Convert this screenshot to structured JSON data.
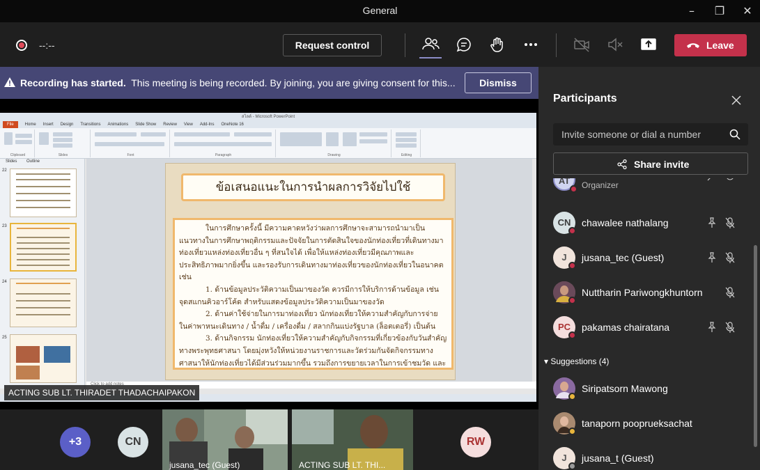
{
  "window": {
    "title": "General"
  },
  "toolbar": {
    "timer": "--:--",
    "request_control_label": "Request control",
    "leave_label": "Leave"
  },
  "banner": {
    "bold": "Recording has started.",
    "text": "This meeting is being recorded. By joining, you are giving consent for this...",
    "dismiss_label": "Dismiss"
  },
  "ppt": {
    "title": "สไลด์ - Microsoft PowerPoint",
    "tabs": [
      "File",
      "Home",
      "Insert",
      "Design",
      "Transitions",
      "Animations",
      "Slide Show",
      "Review",
      "View",
      "Add-Ins",
      "OneNote 16"
    ],
    "ribbon_groups": [
      "Clipboard",
      "Slides",
      "Font",
      "Paragraph",
      "Drawing",
      "Editing"
    ],
    "pane_tabs": [
      "Slides",
      "Outline"
    ],
    "thumb_numbers": [
      "22",
      "23",
      "24",
      "25"
    ],
    "notes_placeholder": "Click to add notes"
  },
  "slide": {
    "title": "ข้อเสนอแนะในการนำผลการวิจัยไปใช้",
    "body": [
      "ในการศึกษาครั้งนี้ มีความคาดหวังว่าผลการศึกษาจะสามารถนำมาเป็นแนวทางในการศึกษาพฤติกรรมและปัจจัยในการตัดสินใจของนักท่องเที่ยวที่เดินทางมาท่องเที่ยวแหล่งท่องเที่ยวอื่น ๆ ที่สนใจได้ เพื่อให้แหล่งท่องเที่ยวมีคุณภาพและประสิทธิภาพมากยิ่งขึ้น และรองรับการเดินทางมาท่องเที่ยวของนักท่องเที่ยวในอนาคต เช่น",
      "1. ด้านข้อมูลประวัติความเป็นมาของวัด ควรมีการให้บริการด้านข้อมูล เช่น จุดสแกนคิวอาร์โค้ด สำหรับแสดงข้อมูลประวัติความเป็นมาของวัด",
      "2. ด้านค่าใช้จ่ายในการมาท่องเที่ยว นักท่องเที่ยวให้ความสำคัญกับการจ่าย ในค่าพาหนะเดินทาง / น้ำดื่ม / เครื่องดื่ม / สลากกินแบ่งรัฐบาล (ล็อตเตอรี่) เป็นต้น",
      "3. ด้านกิจกรรม นักท่องเที่ยวให้ความสำคัญกับกิจกรรมที่เกี่ยวข้องกับวันสำคัญทางพระพุทธศาสนา โดยมุ่งหวังให้หน่วยงานราชการและวัดร่วมกันจัดกิจกรรมทางศาสนาให้นักท่องเที่ยวได้มีส่วนร่วมมากขึ้น รวมถึงการขยายเวลาในการเข้าชมวัด และจัดรอบเข้าชมเพื่อไม่ให้นักท่องเที่ยวมีจำนวนมากเกินไปในแต่ละรอบ"
    ]
  },
  "presenter": {
    "name": "ACTING SUB LT. THIRADET THADACHAIPAKON"
  },
  "gallery": {
    "more_count": "+3",
    "avatars": [
      "CN",
      "RW"
    ],
    "tiles": [
      {
        "label": "jusana_tec (Guest)"
      },
      {
        "label": "ACTING SUB LT. THI..."
      }
    ]
  },
  "participants": {
    "title": "Participants",
    "invite_placeholder": "Invite someone or dial a number",
    "share_invite_label": "Share invite",
    "organizer": {
      "initials": "AT",
      "role": "Organizer"
    },
    "people": [
      {
        "initials": "CN",
        "name": "chawalee nathalang",
        "bg": "#d9e3e5",
        "fg": "#3b3b3b"
      },
      {
        "initials": "J",
        "name": "jusana_tec (Guest)",
        "bg": "#f1e4dc",
        "fg": "#555"
      },
      {
        "initials": "",
        "name": "Nuttharin Pariwongkhuntorn",
        "bg": "#7a5a6a",
        "fg": "#fff"
      },
      {
        "initials": "PC",
        "name": "pakamas chairatana",
        "bg": "#f5dede",
        "fg": "#a33"
      }
    ],
    "suggestions_header": "Suggestions (4)",
    "suggestions": [
      {
        "initials": "",
        "name": "Siripatsorn Mawong",
        "bg": "#8a6aa0"
      },
      {
        "initials": "",
        "name": "tanaporn pooprueksachat",
        "bg": "#a98a70"
      },
      {
        "initials": "J",
        "name": "jusana_t (Guest)",
        "bg": "#f1e4dc"
      }
    ]
  },
  "colors": {
    "accent": "#464775",
    "leave": "#c4314b",
    "panel": "#292929"
  }
}
